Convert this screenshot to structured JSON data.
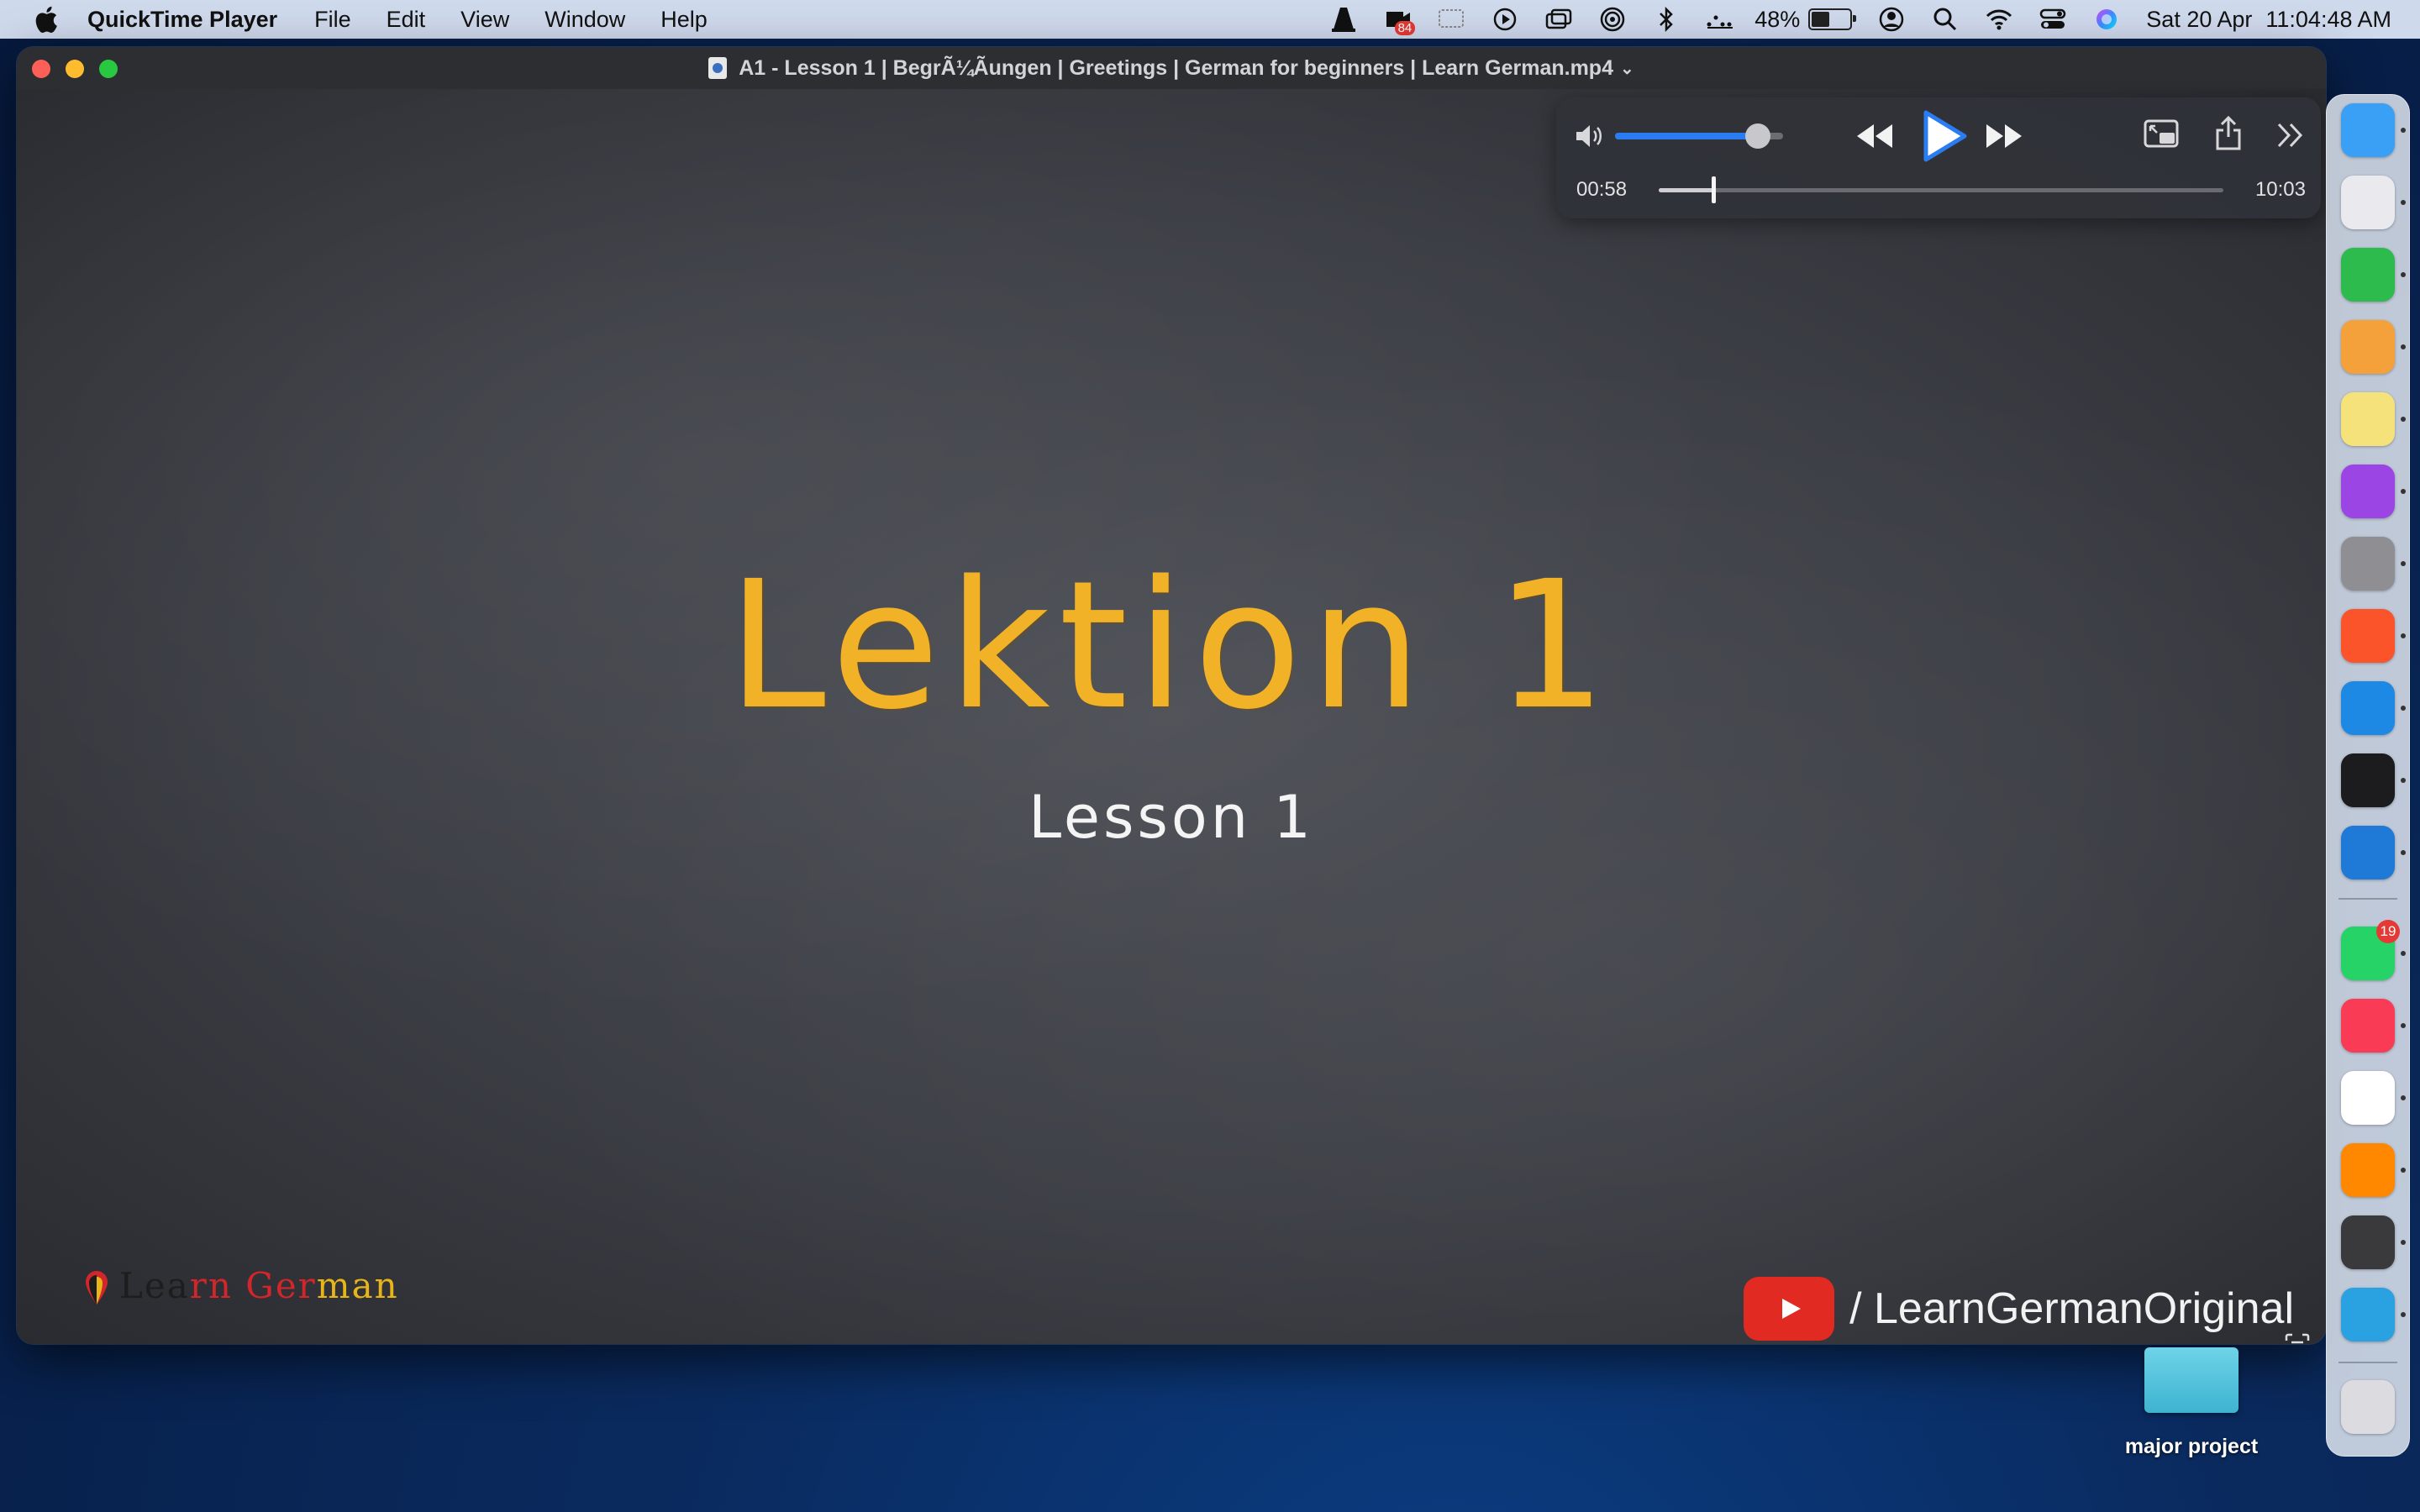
{
  "menubar": {
    "app_name": "QuickTime Player",
    "items": [
      "File",
      "Edit",
      "View",
      "Window",
      "Help"
    ],
    "battery_percent": "48%",
    "battery_level": 0.48,
    "date": "Sat 20 Apr",
    "time": "11:04:48 AM",
    "status_icons": [
      "vlc-icon",
      "record-badge-icon",
      "display-icon",
      "play-circle-icon",
      "windows-icon",
      "airdrop-icon",
      "bluetooth-icon",
      "dots-icon",
      "battery-icon",
      "user-icon",
      "search-icon",
      "wifi-icon",
      "control-center-icon",
      "siri-icon"
    ],
    "record_badge": "84"
  },
  "window": {
    "title": "A1 - Lesson 1 | BegrÃ¼Ãungen | Greetings | German for beginners | Learn German.mp4"
  },
  "video": {
    "heading": "Lektion 1",
    "subheading": "Lesson 1",
    "logo_part1": "Lea",
    "logo_part2": "rn Ger",
    "logo_part3": "man",
    "channel": "/ LearnGermanOriginal",
    "colors": {
      "heading": "#f2b228",
      "logo_red": "#d2262a",
      "logo_yellow": "#e7b51a",
      "youtube": "#e02a22"
    }
  },
  "controls": {
    "current_time": "00:58",
    "total_time": "10:03",
    "progress": 0.0963,
    "volume": 0.85,
    "accent": "#2a7cf3"
  },
  "dock": {
    "apps": [
      {
        "name": "finder",
        "color": "#3aa0f5"
      },
      {
        "name": "launchpad",
        "color": "#e9e9ee"
      },
      {
        "name": "numbers",
        "color": "#2dbb4e"
      },
      {
        "name": "pages",
        "color": "#f4a13c"
      },
      {
        "name": "notes",
        "color": "#f5e27a"
      },
      {
        "name": "podcasts",
        "color": "#9b45e4"
      },
      {
        "name": "system-settings",
        "color": "#8e8e93"
      },
      {
        "name": "brave",
        "color": "#fb542b"
      },
      {
        "name": "safari",
        "color": "#1e88e5"
      },
      {
        "name": "terminal",
        "color": "#1c1c1e"
      },
      {
        "name": "vscode",
        "color": "#1e7ad6"
      },
      {
        "name": "whatsapp",
        "color": "#25d366"
      },
      {
        "name": "music",
        "color": "#fa3b55"
      },
      {
        "name": "chrome",
        "color": "#ffffff"
      },
      {
        "name": "vlc",
        "color": "#ff8800"
      },
      {
        "name": "quicktime",
        "color": "#3a3a3c"
      },
      {
        "name": "telegram",
        "color": "#2aa1e0"
      },
      {
        "name": "trash",
        "color": "#dcdce0"
      }
    ],
    "whatsapp_badge": "19"
  },
  "desktop": {
    "folder_label": "major project"
  }
}
